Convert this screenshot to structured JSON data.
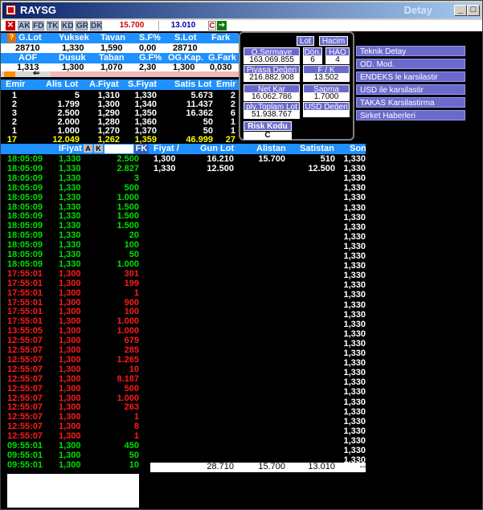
{
  "window": {
    "title": "RAYSG",
    "detay": "Detay",
    "min": "_",
    "max": "□",
    "close": "×"
  },
  "toolbar": {
    "buttons": [
      "AK",
      "FD",
      "TK",
      "KD",
      "GR",
      "DK"
    ],
    "price1": "15.700",
    "price2": "13.010",
    "c_label": "C"
  },
  "summary": {
    "row1_headers": [
      "G.Lot",
      "Yuksek",
      "Tavan",
      "S.F%",
      "S.Lot",
      "Fark"
    ],
    "row1_values": [
      "28710",
      "1,330",
      "1,590",
      "0,00",
      "28710",
      ""
    ],
    "row2_headers": [
      "AOF",
      "Dusuk",
      "Taban",
      "G.F%",
      "OG.Kap.",
      "G.Fark"
    ],
    "row2_values": [
      "1,313",
      "1,300",
      "1,070",
      "2,30",
      "1,300",
      "0,030"
    ]
  },
  "depth": {
    "headers": [
      "Emir",
      "Alis Lot",
      "A.Fiyat",
      "S.Fiyat",
      "Satis Lot",
      "Emir"
    ],
    "rows": [
      [
        "1",
        "5",
        "1,310",
        "1,330",
        "5.673",
        "2"
      ],
      [
        "2",
        "1.799",
        "1,300",
        "1,340",
        "11.437",
        "2"
      ],
      [
        "3",
        "2.500",
        "1,290",
        "1,350",
        "16.362",
        "6"
      ],
      [
        "2",
        "2.000",
        "1,280",
        "1,360",
        "50",
        "1"
      ],
      [
        "1",
        "1.000",
        "1,270",
        "1,370",
        "50",
        "1"
      ]
    ],
    "total": [
      "17",
      "12.049",
      "1,262",
      "1,359",
      "46.999",
      "27"
    ]
  },
  "panel": {
    "lot": "Lot",
    "hacim": "Hacim",
    "osermaye_label": "O.Sermaye",
    "osermaye": "163.069.855",
    "don_label": "Dön.",
    "don": "6",
    "hao_label": "HAO",
    "hao": "4",
    "piyasa_label": "Piyasa Değeri",
    "piyasa": "216.882.908",
    "fk_label": "F / K",
    "fk": "13.502",
    "netkar_label": "Net Kar",
    "netkar": "16.062.786",
    "sapma_label": "Sapma",
    "sapma": "1.7000",
    "ply_label": "ply.Toplam Lot",
    "ply": "51.938.767",
    "usd_label": "USD Değeri",
    "usd": "",
    "risk_label": "Risk Kodu",
    "risk": "C"
  },
  "menu": [
    "Teknik Detay",
    "OD. Mod.",
    "ENDEKS le karsilastir",
    "USD ile karsilastir",
    "TAKAS Karsilastirma",
    "Sirket Haberleri"
  ],
  "trades_header": {
    "fiyat": "IFiyat",
    "a": "A",
    "k": "K",
    "fk": "FK"
  },
  "trades": [
    {
      "t": "18:05:09",
      "p": "1,330",
      "l": "2.500",
      "c": "g"
    },
    {
      "t": "18:05:09",
      "p": "1,330",
      "l": "2.827",
      "c": "g"
    },
    {
      "t": "18:05:09",
      "p": "1,330",
      "l": "3",
      "c": "g"
    },
    {
      "t": "18:05:09",
      "p": "1,330",
      "l": "500",
      "c": "g"
    },
    {
      "t": "18:05:09",
      "p": "1,330",
      "l": "1.000",
      "c": "g"
    },
    {
      "t": "18:05:09",
      "p": "1,330",
      "l": "1.500",
      "c": "g"
    },
    {
      "t": "18:05:09",
      "p": "1,330",
      "l": "1.500",
      "c": "g"
    },
    {
      "t": "18:05:09",
      "p": "1,330",
      "l": "1.500",
      "c": "g"
    },
    {
      "t": "18:05:09",
      "p": "1,330",
      "l": "20",
      "c": "g"
    },
    {
      "t": "18:05:09",
      "p": "1,330",
      "l": "100",
      "c": "g"
    },
    {
      "t": "18:05:09",
      "p": "1,330",
      "l": "50",
      "c": "g"
    },
    {
      "t": "18:05:09",
      "p": "1,330",
      "l": "1.000",
      "c": "g"
    },
    {
      "t": "17:55:01",
      "p": "1,300",
      "l": "301",
      "c": "r"
    },
    {
      "t": "17:55:01",
      "p": "1,300",
      "l": "199",
      "c": "r"
    },
    {
      "t": "17:55:01",
      "p": "1,300",
      "l": "1",
      "c": "r"
    },
    {
      "t": "17:55:01",
      "p": "1,300",
      "l": "900",
      "c": "r"
    },
    {
      "t": "17:55:01",
      "p": "1,300",
      "l": "100",
      "c": "r"
    },
    {
      "t": "17:55:01",
      "p": "1,300",
      "l": "1.000",
      "c": "r"
    },
    {
      "t": "13:55:05",
      "p": "1,300",
      "l": "1.000",
      "c": "r"
    },
    {
      "t": "12:55:07",
      "p": "1,300",
      "l": "679",
      "c": "r"
    },
    {
      "t": "12:55:07",
      "p": "1,300",
      "l": "285",
      "c": "r"
    },
    {
      "t": "12:55:07",
      "p": "1,300",
      "l": "1.265",
      "c": "r"
    },
    {
      "t": "12:55:07",
      "p": "1,300",
      "l": "10",
      "c": "r"
    },
    {
      "t": "12:55:07",
      "p": "1,300",
      "l": "8.187",
      "c": "r"
    },
    {
      "t": "12:55:07",
      "p": "1,300",
      "l": "500",
      "c": "r"
    },
    {
      "t": "12:55:07",
      "p": "1,300",
      "l": "1.000",
      "c": "r"
    },
    {
      "t": "12:55:07",
      "p": "1,300",
      "l": "263",
      "c": "r"
    },
    {
      "t": "12:55:07",
      "p": "1,300",
      "l": "1",
      "c": "r"
    },
    {
      "t": "12:55:07",
      "p": "1,300",
      "l": "8",
      "c": "r"
    },
    {
      "t": "12:55:07",
      "p": "1,300",
      "l": "1",
      "c": "r"
    },
    {
      "t": "09:55:01",
      "p": "1,300",
      "l": "450",
      "c": "g"
    },
    {
      "t": "09:55:01",
      "p": "1,300",
      "l": "50",
      "c": "g"
    },
    {
      "t": "09:55:01",
      "p": "1,300",
      "l": "10",
      "c": "g"
    }
  ],
  "summary_table": {
    "headers": [
      "Fiyat /",
      "Gun Lot",
      "Alistan",
      "Satistan",
      "Son"
    ],
    "rows": [
      [
        "1,300",
        "16.210",
        "15.700",
        "510",
        "1,330"
      ],
      [
        "1,330",
        "12.500",
        "",
        "12.500",
        "1,330"
      ]
    ],
    "son_repeat": "1,330",
    "footer": [
      "28.710",
      "15.700",
      "13.010",
      "--"
    ]
  }
}
